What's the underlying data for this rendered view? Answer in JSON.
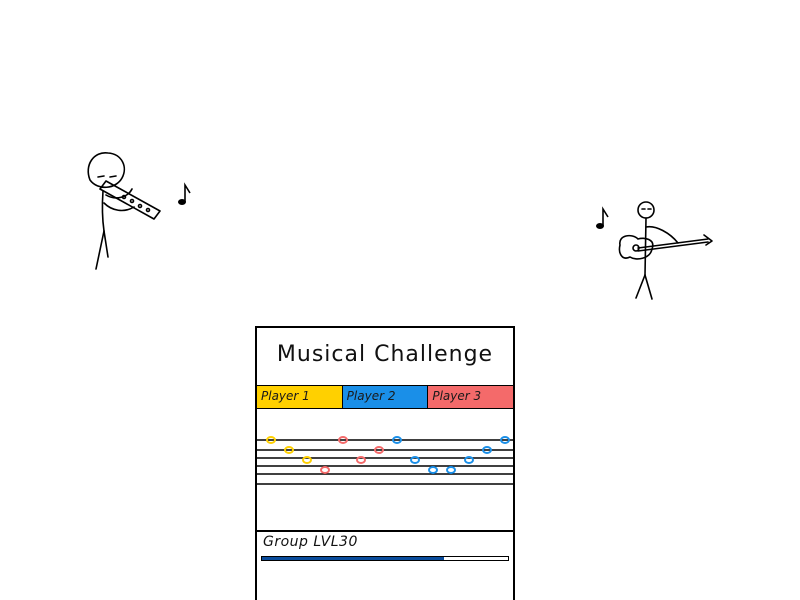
{
  "game": {
    "title": "Musical Challenge",
    "players": [
      {
        "label": "Player 1",
        "color": "#ffd000"
      },
      {
        "label": "Player 2",
        "color": "#1a8fe8"
      },
      {
        "label": "Player 3",
        "color": "#f46a6a"
      }
    ],
    "group_label": "Group LVL30",
    "group_progress_percent": 74,
    "progress_color": "#0a4c9c"
  },
  "characters": [
    {
      "role": "flute-player",
      "instrument": "flute",
      "icon": "music-note-icon"
    },
    {
      "role": "guitar-player",
      "instrument": "guitar",
      "icon": "music-note-icon"
    }
  ],
  "notes": [
    {
      "player": 1,
      "step": 0,
      "line": 0
    },
    {
      "player": 1,
      "step": 1,
      "line": 1
    },
    {
      "player": 1,
      "step": 2,
      "line": 2
    },
    {
      "player": 3,
      "step": 3,
      "line": 3
    },
    {
      "player": 3,
      "step": 4,
      "line": 0
    },
    {
      "player": 3,
      "step": 5,
      "line": 2
    },
    {
      "player": 3,
      "step": 6,
      "line": 1
    },
    {
      "player": 2,
      "step": 7,
      "line": 0
    },
    {
      "player": 2,
      "step": 8,
      "line": 2
    },
    {
      "player": 2,
      "step": 9,
      "line": 3
    },
    {
      "player": 2,
      "step": 10,
      "line": 3
    },
    {
      "player": 2,
      "step": 11,
      "line": 2
    },
    {
      "player": 2,
      "step": 12,
      "line": 1
    },
    {
      "player": 2,
      "step": 13,
      "line": 0
    }
  ]
}
